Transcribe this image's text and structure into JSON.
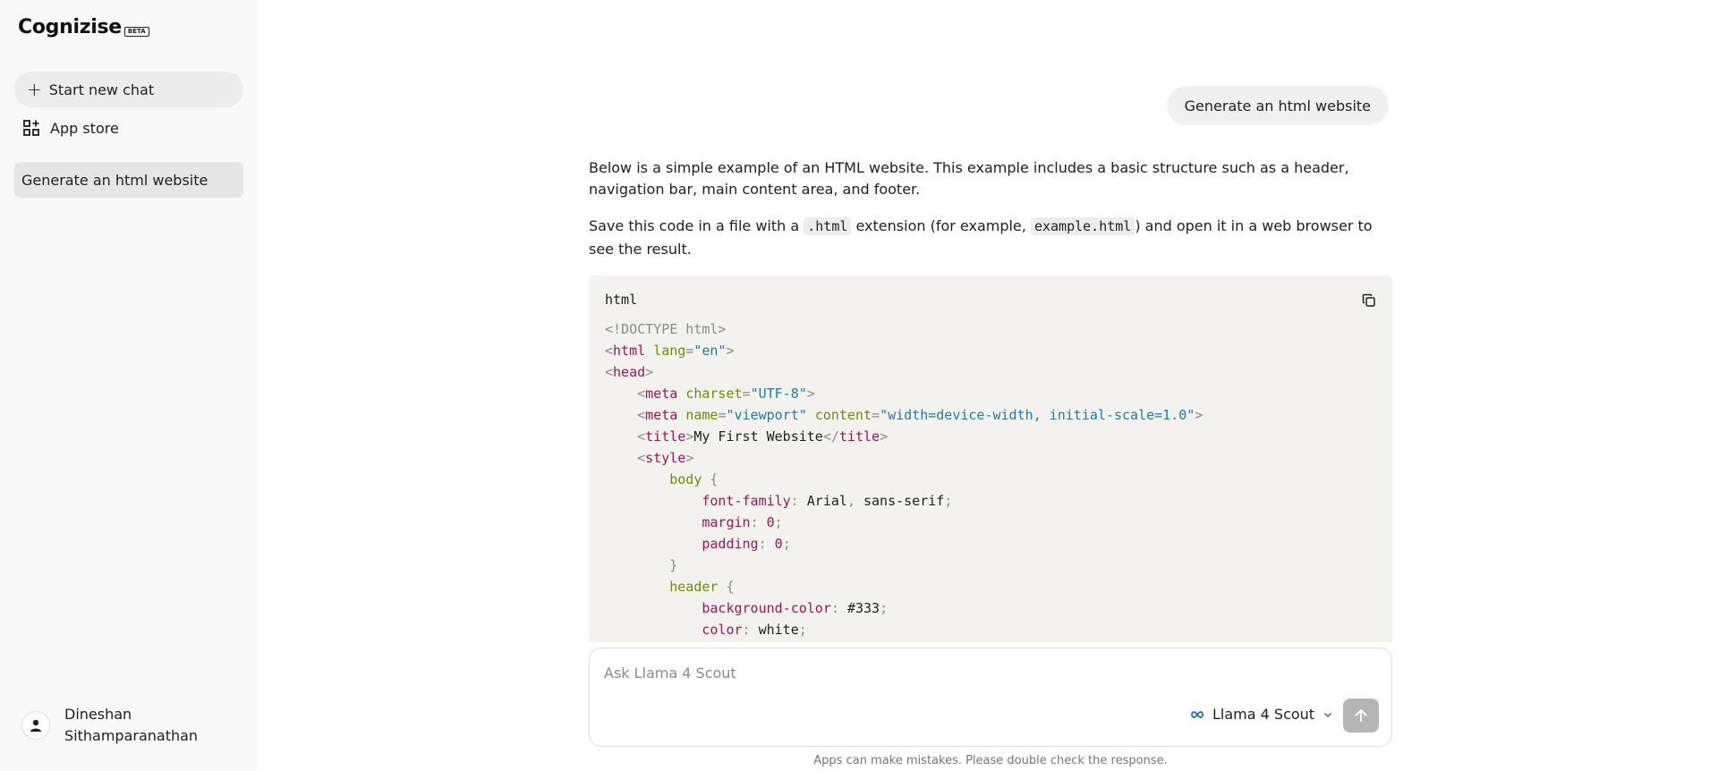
{
  "sidebar": {
    "logo_text": "Cognizise",
    "logo_badge": "BETA",
    "new_chat_label": "Start new chat",
    "app_store_label": "App store",
    "history": [
      {
        "label": "Generate an html website"
      }
    ],
    "user_name": "Dineshan Sithamparanathan"
  },
  "chat": {
    "user_message": "Generate an html website",
    "answer": {
      "para1": "Below is a simple example of an HTML website. This example includes a basic structure such as a header, navigation bar, main content area, and footer.",
      "para2_part1": "Save this code in a file with a ",
      "para2_code1": ".html",
      "para2_part2": " extension (for example, ",
      "para2_code2": "example.html",
      "para2_part3": ") and open it in a web browser to see the result."
    },
    "code_block": {
      "language": "html",
      "lines": [
        "<!DOCTYPE html>",
        "<html lang=\"en\">",
        "<head>",
        "    <meta charset=\"UTF-8\">",
        "    <meta name=\"viewport\" content=\"width=device-width, initial-scale=1.0\">",
        "    <title>My First Website</title>",
        "    <style>",
        "        body {",
        "            font-family: Arial, sans-serif;",
        "            margin: 0;",
        "            padding: 0;",
        "        }",
        "        header {",
        "            background-color: #333;",
        "            color: white;"
      ]
    }
  },
  "composer": {
    "placeholder": "Ask Llama 4 Scout",
    "model_name": "Llama 4 Scout",
    "disclaimer": "Apps can make mistakes. Please double check the response."
  },
  "colors": {
    "sidebar_bg": "#f8f8f8",
    "code_bg": "#f4f2ef",
    "send_button": "#b5b5b5",
    "meta_blue": "#0668e1"
  }
}
